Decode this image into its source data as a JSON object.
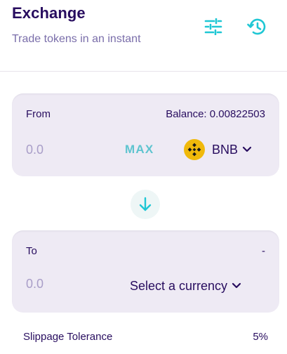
{
  "header": {
    "title": "Exchange",
    "subtitle": "Trade tokens in an instant",
    "settings_icon": "settings-sliders-icon",
    "history_icon": "history-icon"
  },
  "from": {
    "label": "From",
    "balance": "Balance: 0.00822503",
    "amount_placeholder": "0.0",
    "max_label": "MAX",
    "token_symbol": "BNB",
    "token_icon": "bnb-logo-icon"
  },
  "switch": {
    "icon": "arrow-down-icon"
  },
  "to": {
    "label": "To",
    "balance": "-",
    "amount_placeholder": "0.0",
    "select_label": "Select a currency"
  },
  "slippage": {
    "label": "Slippage Tolerance",
    "value": "5%"
  },
  "colors": {
    "primary_text": "#280d5f",
    "secondary_text": "#7a6eaa",
    "accent": "#1fc7d4",
    "card_bg": "#eeeaf4",
    "bnb_yellow": "#f0b90b"
  }
}
